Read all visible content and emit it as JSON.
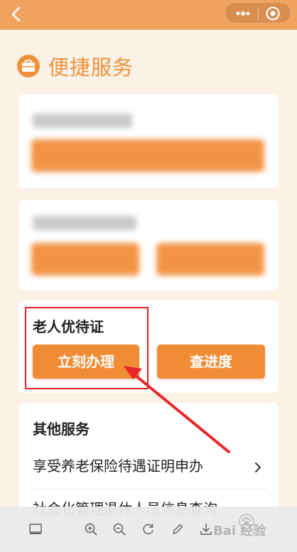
{
  "section": {
    "title": "便捷服务"
  },
  "elder_card": {
    "title": "老人优待证",
    "apply_label": "立刻办理",
    "progress_label": "查进度"
  },
  "other_services": {
    "title": "其他服务",
    "items": [
      {
        "label": "享受养老保险待遇证明申办"
      },
      {
        "label": "社会化管理退休人员信息查询"
      }
    ]
  },
  "watermark": {
    "text": "Bai 经验"
  },
  "colors": {
    "accent": "#f08c35",
    "topbar": "#f0a35e",
    "annotation": "#e02020"
  },
  "icons": {
    "back": "back-arrow-icon",
    "more": "more-dots-icon",
    "close": "mini-program-close-icon",
    "section": "briefcase-icon",
    "chevron": "chevron-right-icon",
    "toolbar": [
      "layout-icon",
      "zoom-in-icon",
      "zoom-out-icon",
      "rotate-icon",
      "edit-icon",
      "download-icon"
    ]
  }
}
